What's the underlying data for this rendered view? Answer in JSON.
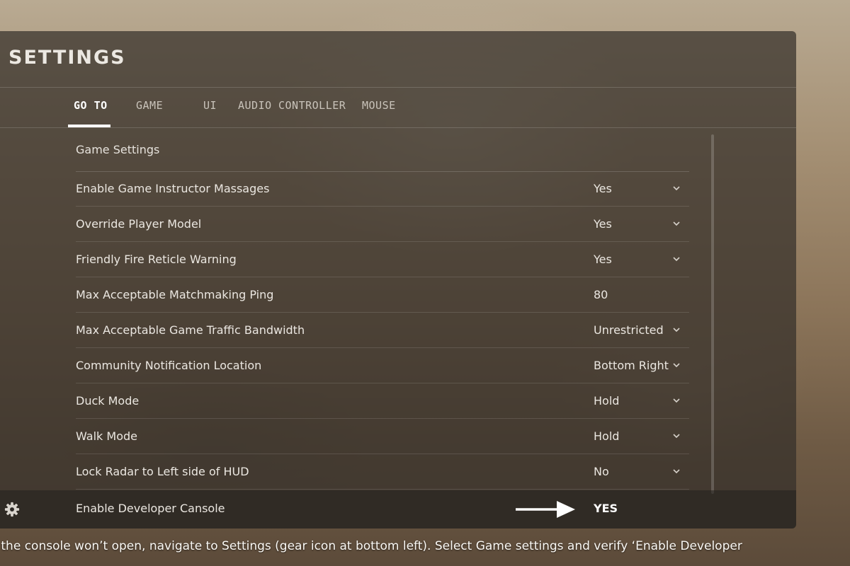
{
  "header": {
    "title": "SETTINGS"
  },
  "tabs": [
    {
      "label": "GO TO",
      "active": true
    },
    {
      "label": "GAME",
      "active": false
    },
    {
      "label": "UI",
      "active": false
    },
    {
      "label": "AUDIO",
      "active": false
    },
    {
      "label": "CONTROLLER",
      "active": false
    },
    {
      "label": "MOUSE",
      "active": false
    }
  ],
  "section": {
    "title": "Game Settings"
  },
  "settings": [
    {
      "label": "Enable Game Instructor Massages",
      "value": "Yes",
      "dropdown": true
    },
    {
      "label": "Override Player Model",
      "value": "Yes",
      "dropdown": true
    },
    {
      "label": "Friendly Fire Reticle Warning",
      "value": "Yes",
      "dropdown": true
    },
    {
      "label": "Max Acceptable Matchmaking Ping",
      "value": "80",
      "dropdown": false
    },
    {
      "label": "Max Acceptable Game Traffic Bandwidth",
      "value": "Unrestricted",
      "dropdown": true
    },
    {
      "label": "Community Notification Location",
      "value": "Bottom Right",
      "dropdown": true
    },
    {
      "label": "Duck Mode",
      "value": "Hold",
      "dropdown": true
    },
    {
      "label": "Walk Mode",
      "value": "Hold",
      "dropdown": true
    },
    {
      "label": "Lock Radar to Left side of HUD",
      "value": "No",
      "dropdown": true
    }
  ],
  "highlight": {
    "label": "Enable Developer Cansole",
    "value": "YES"
  },
  "caption": {
    "text": "f the console won’t open, navigate to Settings (gear icon at bottom left). Select Game settings and verify ‘Enable Developer"
  },
  "icons": {
    "settings": "gear-icon",
    "dropdown": "chevron-down-icon",
    "pointer": "arrow-right-icon"
  },
  "colors": {
    "panel": "#342f29",
    "text": "#ebe7e1",
    "accent": "#ffffff"
  }
}
